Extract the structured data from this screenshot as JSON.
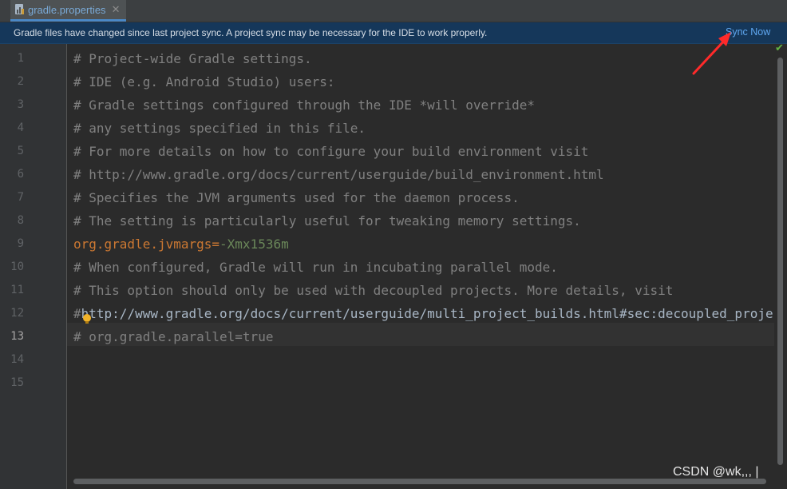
{
  "tab": {
    "label": "gradle.properties",
    "close_glyph": "✕",
    "icon": "gradle-file-icon"
  },
  "banner": {
    "message": "Gradle files have changed since last project sync. A project sync may be necessary for the IDE to work properly.",
    "action": "Sync Now"
  },
  "editor": {
    "current_line": 13,
    "status_icon": "check-icon",
    "status_glyph": "✔",
    "line_numbers": [
      "1",
      "2",
      "3",
      "4",
      "5",
      "6",
      "7",
      "8",
      "9",
      "10",
      "11",
      "12",
      "13",
      "14",
      "15"
    ],
    "lines": [
      {
        "comment": "# Project-wide Gradle settings."
      },
      {
        "comment": "# IDE (e.g. Android Studio) users:"
      },
      {
        "comment": "# Gradle settings configured through the IDE *will override*"
      },
      {
        "comment": "# any settings specified in this file."
      },
      {
        "comment": "# For more details on how to configure your build environment visit"
      },
      {
        "comment": "# http://www.gradle.org/docs/current/userguide/build_environment.html"
      },
      {
        "comment": "# Specifies the JVM arguments used for the daemon process."
      },
      {
        "comment": "# The setting is particularly useful for tweaking memory settings."
      },
      {
        "key": "org.gradle.jvmargs",
        "eq": "=",
        "val": "-Xmx1536m"
      },
      {
        "comment": "# When configured, Gradle will run in incubating parallel mode."
      },
      {
        "comment": "# This option should only be used with decoupled projects. More details, visit"
      },
      {
        "hash": "#",
        "plain": "http://www.gradle.org/docs/current/userguide/multi_project_builds.html#sec:decoupled_projects"
      },
      {
        "comment": "# org.gradle.parallel=true"
      }
    ]
  },
  "colors": {
    "background": "#2b2b2b",
    "banner": "#15375a",
    "link": "#5fa7f0",
    "comment": "#808080",
    "key": "#cc7832",
    "value": "#6a8759",
    "annotation_arrow": "#ff2a2a"
  },
  "watermark": "CSDN @wk,,, |"
}
